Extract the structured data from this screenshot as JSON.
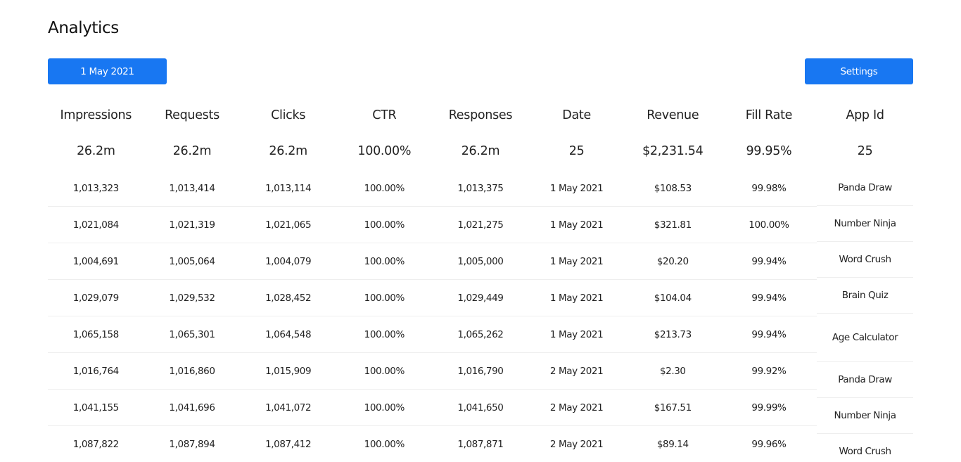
{
  "page": {
    "title": "Analytics"
  },
  "toolbar": {
    "date_button": "1 May 2021",
    "settings_button": "Settings"
  },
  "colors": {
    "accent": "#1877f2",
    "row_divider": "#eeeeee"
  },
  "table": {
    "columns": [
      {
        "key": "impressions",
        "label": "Impressions",
        "total": "26.2m"
      },
      {
        "key": "requests",
        "label": "Requests",
        "total": "26.2m"
      },
      {
        "key": "clicks",
        "label": "Clicks",
        "total": "26.2m"
      },
      {
        "key": "ctr",
        "label": "CTR",
        "total": "100.00%"
      },
      {
        "key": "responses",
        "label": "Responses",
        "total": "26.2m"
      },
      {
        "key": "date",
        "label": "Date",
        "total": "25"
      },
      {
        "key": "revenue",
        "label": "Revenue",
        "total": "$2,231.54"
      },
      {
        "key": "fill_rate",
        "label": "Fill Rate",
        "total": "99.95%"
      },
      {
        "key": "app_id",
        "label": "App Id",
        "total": "25"
      }
    ],
    "rows": [
      {
        "impressions": "1,013,323",
        "requests": "1,013,414",
        "clicks": "1,013,114",
        "ctr": "100.00%",
        "responses": "1,013,375",
        "date": "1 May 2021",
        "revenue": "$108.53",
        "fill_rate": "99.98%"
      },
      {
        "impressions": "1,021,084",
        "requests": "1,021,319",
        "clicks": "1,021,065",
        "ctr": "100.00%",
        "responses": "1,021,275",
        "date": "1 May 2021",
        "revenue": "$321.81",
        "fill_rate": "100.00%"
      },
      {
        "impressions": "1,004,691",
        "requests": "1,005,064",
        "clicks": "1,004,079",
        "ctr": "100.00%",
        "responses": "1,005,000",
        "date": "1 May 2021",
        "revenue": "$20.20",
        "fill_rate": "99.94%"
      },
      {
        "impressions": "1,029,079",
        "requests": "1,029,532",
        "clicks": "1,028,452",
        "ctr": "100.00%",
        "responses": "1,029,449",
        "date": "1 May 2021",
        "revenue": "$104.04",
        "fill_rate": "99.94%"
      },
      {
        "impressions": "1,065,158",
        "requests": "1,065,301",
        "clicks": "1,064,548",
        "ctr": "100.00%",
        "responses": "1,065,262",
        "date": "1 May 2021",
        "revenue": "$213.73",
        "fill_rate": "99.94%"
      },
      {
        "impressions": "1,016,764",
        "requests": "1,016,860",
        "clicks": "1,015,909",
        "ctr": "100.00%",
        "responses": "1,016,790",
        "date": "2 May 2021",
        "revenue": "$2.30",
        "fill_rate": "99.92%"
      },
      {
        "impressions": "1,041,155",
        "requests": "1,041,696",
        "clicks": "1,041,072",
        "ctr": "100.00%",
        "responses": "1,041,650",
        "date": "2 May 2021",
        "revenue": "$167.51",
        "fill_rate": "99.99%"
      },
      {
        "impressions": "1,087,822",
        "requests": "1,087,894",
        "clicks": "1,087,412",
        "ctr": "100.00%",
        "responses": "1,087,871",
        "date": "2 May 2021",
        "revenue": "$89.14",
        "fill_rate": "99.96%"
      }
    ],
    "app_ids": [
      "Panda Draw",
      "Number Ninja",
      "Word Crush",
      "Brain Quiz",
      "Age Calculator",
      "Panda Draw",
      "Number Ninja",
      "Word Crush"
    ]
  }
}
